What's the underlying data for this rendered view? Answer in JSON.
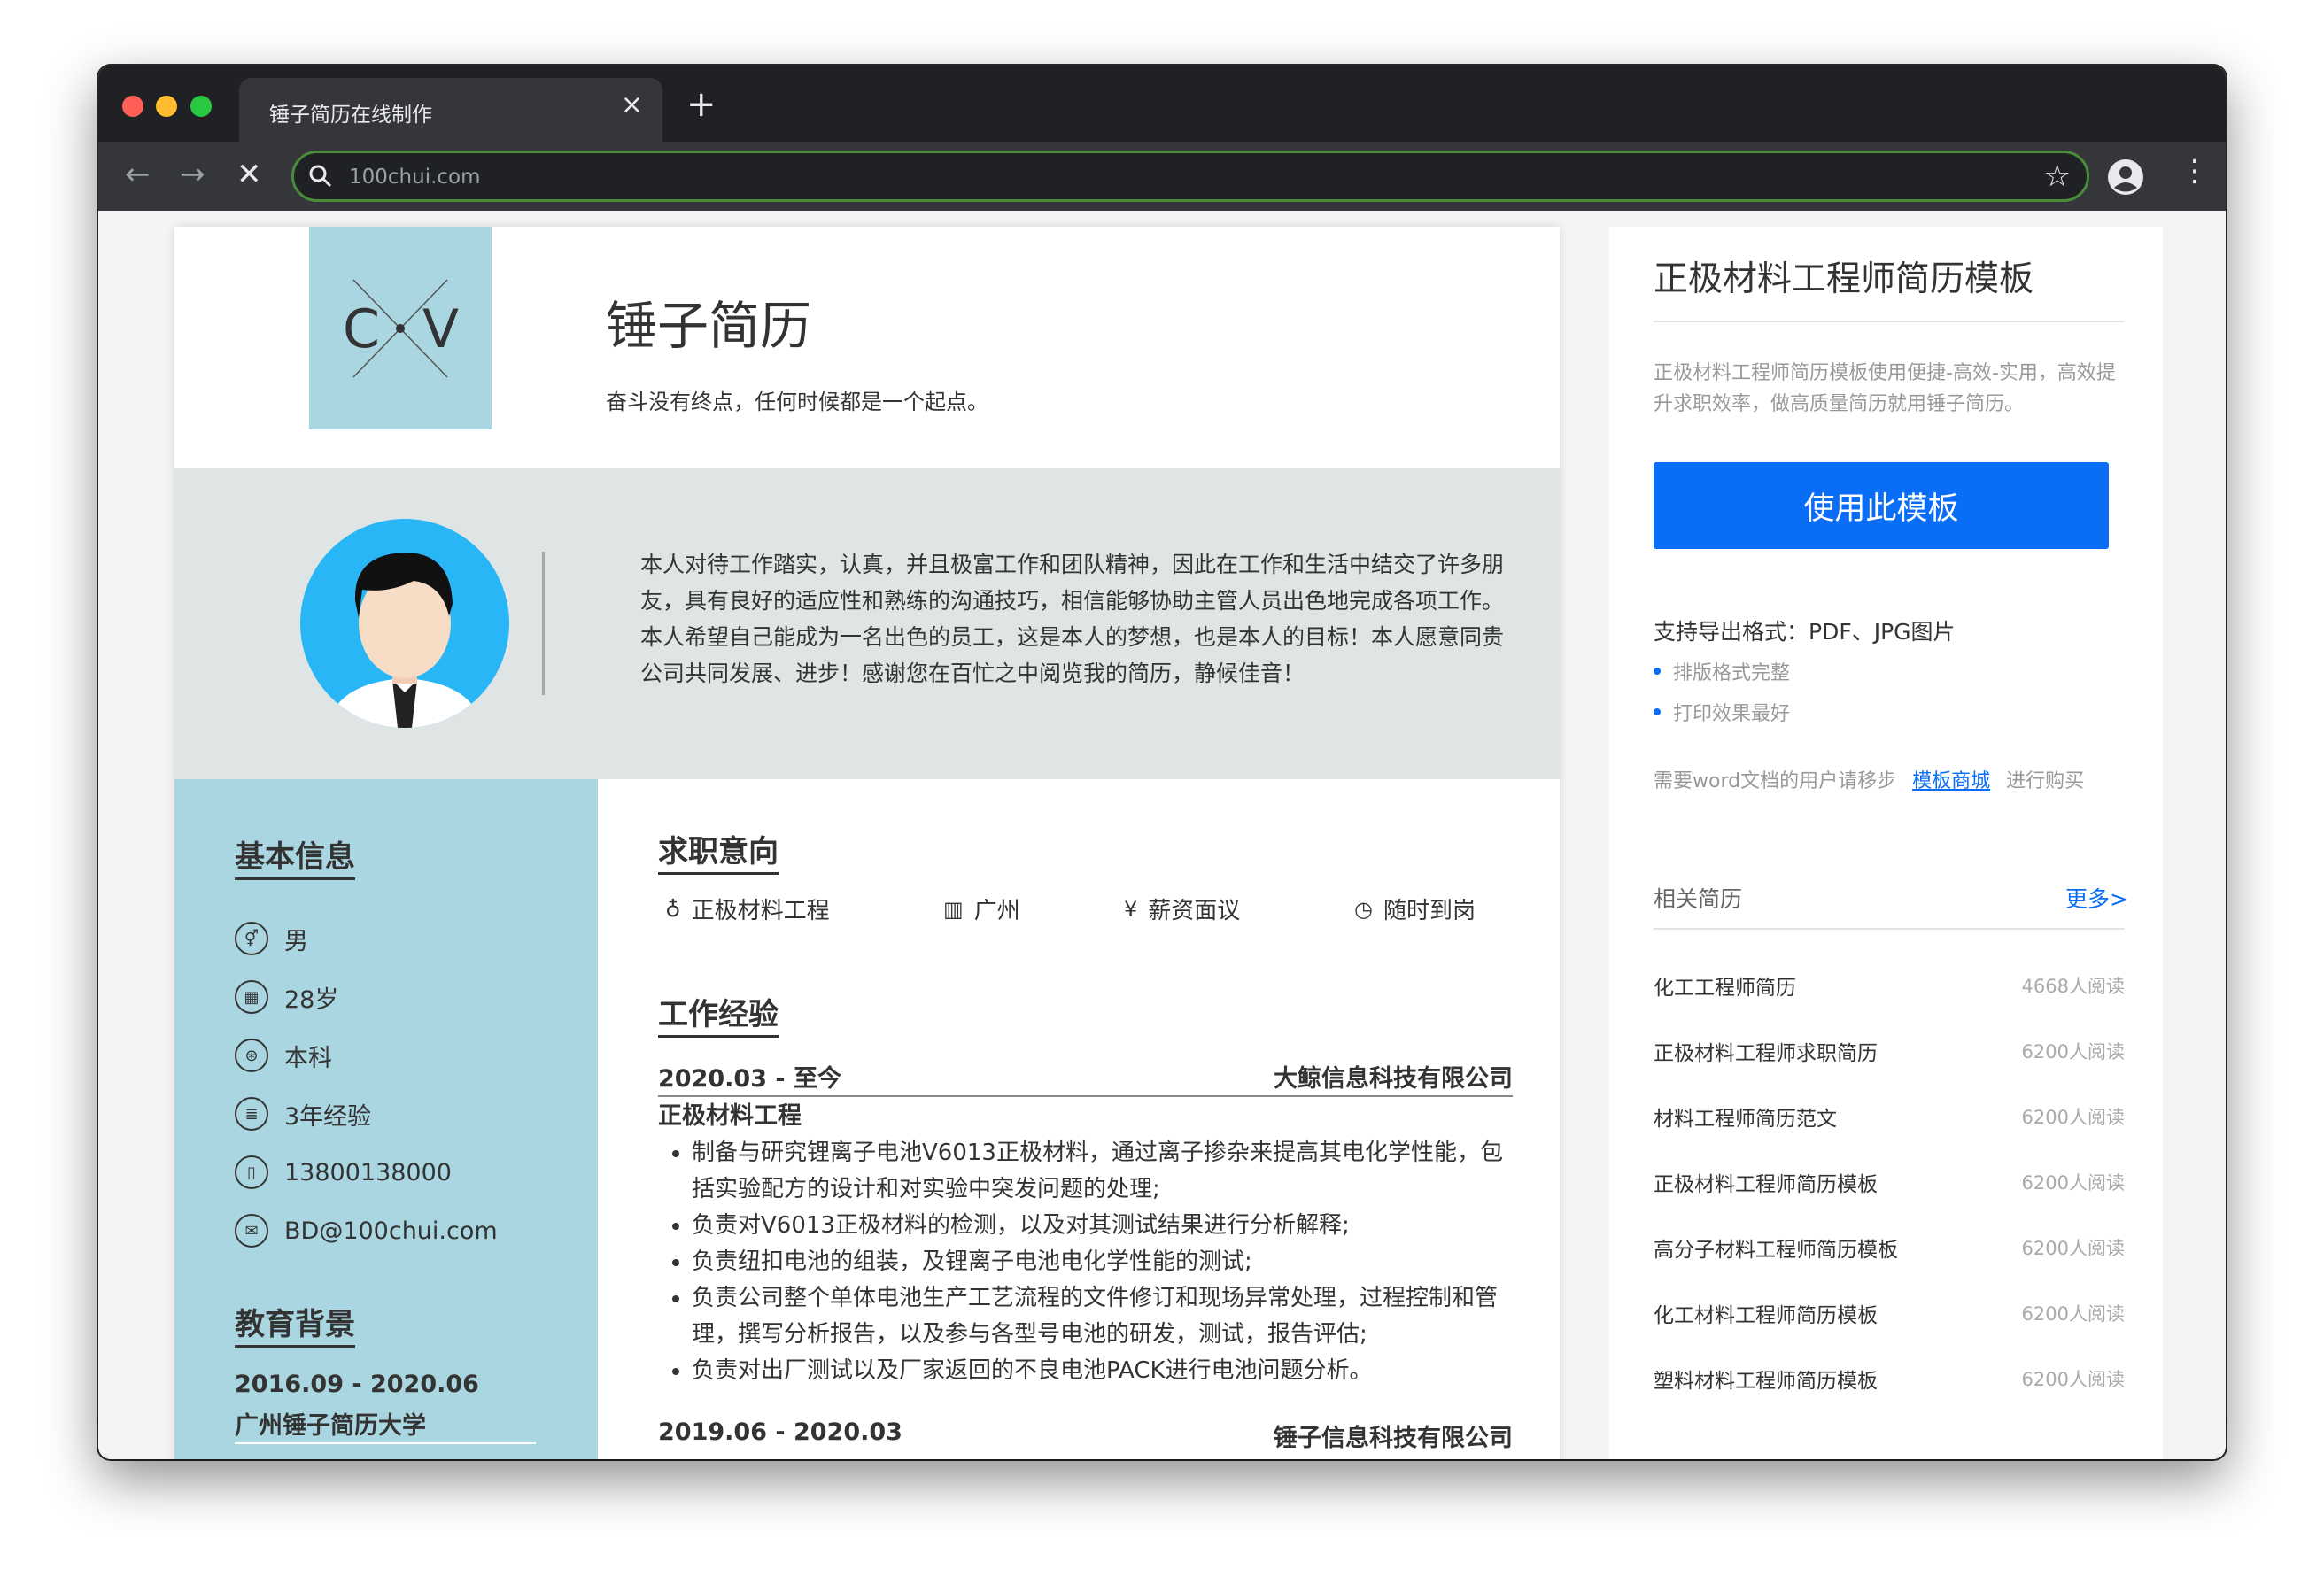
{
  "browser": {
    "tab_title": "锤子简历在线制作",
    "tab_close": "×",
    "new_tab": "+",
    "url": "100chui.com",
    "nav_back": "←",
    "nav_forward": "→",
    "nav_stop": "✕",
    "bookmark_star": "☆",
    "menu": "⋮"
  },
  "resume": {
    "logo_text": "CV",
    "name": "锤子简历",
    "motto": "奋斗没有终点，任何时候都是一个起点。",
    "summary": "本人对待工作踏实，认真，并且极富工作和团队精神，因此在工作和生活中结交了许多朋友，具有良好的适应性和熟练的沟通技巧，相信能够协助主管人员出色地完成各项工作。本人希望自己能成为一名出色的员工，这是本人的梦想，也是本人的目标！本人愿意同贵公司共同发展、进步！感谢您在百忙之中阅览我的简历，静候佳音！",
    "basic_title": "基本信息",
    "basic": [
      {
        "icon": "gender-icon",
        "glyph": "⚥",
        "text": "男"
      },
      {
        "icon": "age-icon",
        "glyph": "▦",
        "text": "28岁"
      },
      {
        "icon": "education-icon",
        "glyph": "⊛",
        "text": "本科"
      },
      {
        "icon": "experience-icon",
        "glyph": "≣",
        "text": "3年经验"
      },
      {
        "icon": "phone-icon",
        "glyph": "▯",
        "text": "13800138000"
      },
      {
        "icon": "email-icon",
        "glyph": "✉",
        "text": "BD@100chui.com"
      }
    ],
    "edu_title": "教育背景",
    "edu_date": "2016.09 - 2020.06",
    "edu_school": "广州锤子简历大学",
    "intent_title": "求职意向",
    "intent": [
      {
        "icon": "job-icon",
        "glyph": "♁",
        "text": "正极材料工程"
      },
      {
        "icon": "city-icon",
        "glyph": "▥",
        "text": "广州"
      },
      {
        "icon": "salary-icon",
        "glyph": "¥",
        "text": "薪资面议"
      },
      {
        "icon": "clock-icon",
        "glyph": "◷",
        "text": "随时到岗"
      }
    ],
    "work_title": "工作经验",
    "jobs": [
      {
        "period": "2020.03 - 至今",
        "company": "大鲸信息科技有限公司",
        "title": "正极材料工程",
        "duties": [
          "制备与研究锂离子电池V6013正极材料，通过离子掺杂来提高其电化学性能，包括实验配方的设计和对实验中突发问题的处理;",
          "负责对V6013正极材料的检测，以及对其测试结果进行分析解释;",
          "负责纽扣电池的组装，及锂离子电池电化学性能的测试;",
          "负责公司整个单体电池生产工艺流程的文件修订和现场异常处理，过程控制和管理，撰写分析报告，以及参与各型号电池的研发，测试，报告评估;",
          "负责对出厂测试以及厂家返回的不良电池PACK进行电池问题分析。"
        ]
      },
      {
        "period": "2019.06 - 2020.03",
        "company": "锤子信息科技有限公司"
      }
    ]
  },
  "sidebar": {
    "title": "正极材料工程师简历模板",
    "desc": "正极材料工程师简历模板使用便捷-高效-实用，高效提升求职效率，做高质量简历就用锤子简历。",
    "use_button": "使用此模板",
    "export": "支持导出格式：PDF、JPG图片",
    "features": [
      "排版格式完整",
      "打印效果最好"
    ],
    "word_note_prefix": "需要word文档的用户请移步",
    "word_note_link": "模板商城",
    "word_note_suffix": "进行购买",
    "related_title": "相关简历",
    "more": "更多>",
    "related": [
      {
        "name": "化工工程师简历",
        "reads": "4668人阅读"
      },
      {
        "name": "正极材料工程师求职简历",
        "reads": "6200人阅读"
      },
      {
        "name": "材料工程师简历范文",
        "reads": "6200人阅读"
      },
      {
        "name": "正极材料工程师简历模板",
        "reads": "6200人阅读"
      },
      {
        "name": "高分子材料工程师简历模板",
        "reads": "6200人阅读"
      },
      {
        "name": "化工材料工程师简历模板",
        "reads": "6200人阅读"
      },
      {
        "name": "塑料材料工程师简历模板",
        "reads": "6200人阅读"
      }
    ]
  },
  "colors": {
    "accent": "#0a6df5",
    "resume_blue": "#a9d6e0",
    "summary_gray": "#dfe5e5",
    "chrome_dark": "#202124"
  }
}
